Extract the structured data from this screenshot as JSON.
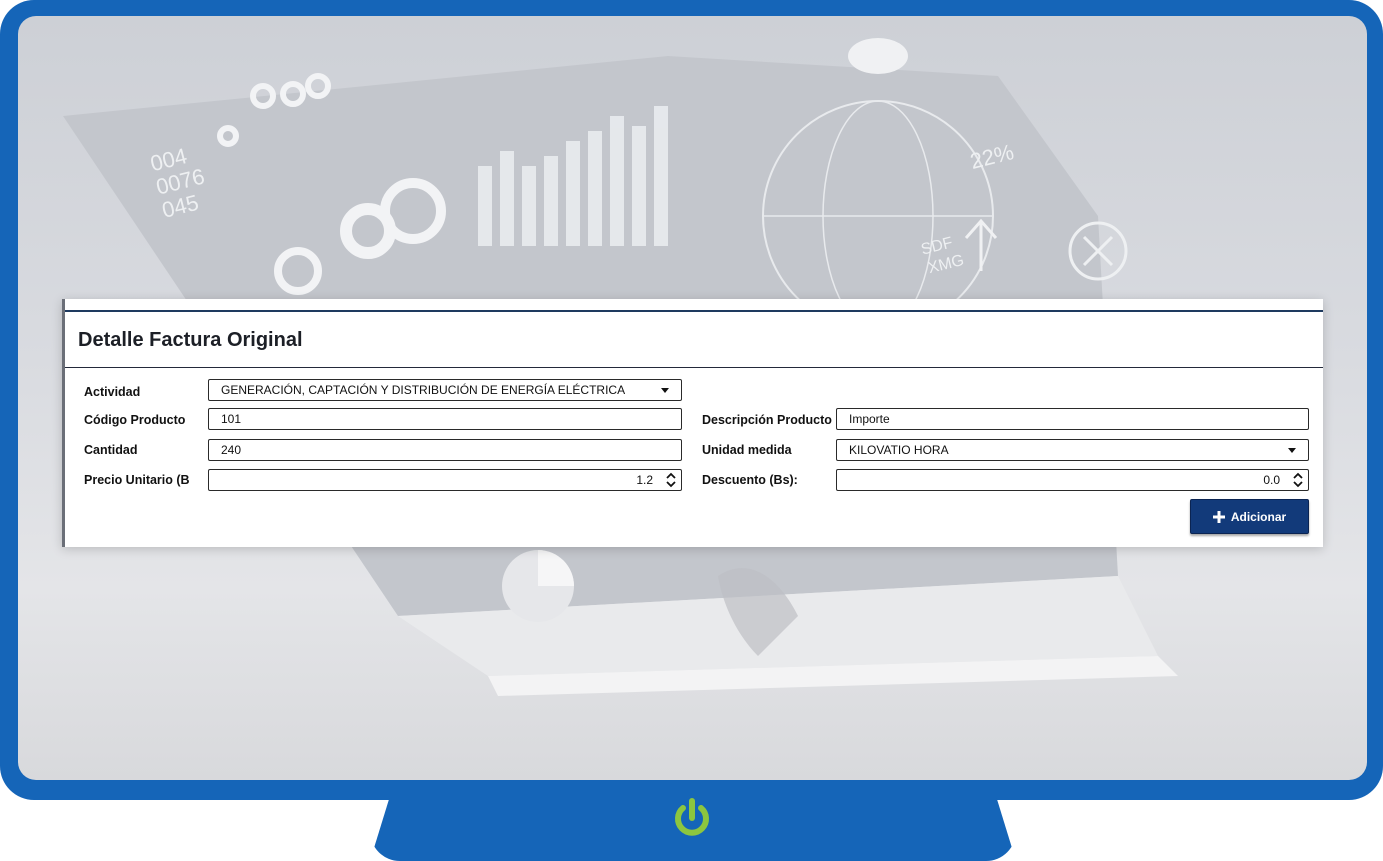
{
  "form": {
    "title": "Detalle Factura Original",
    "actividad": {
      "label": "Actividad",
      "value": "GENERACIÓN, CAPTACIÓN Y DISTRIBUCIÓN DE ENERGÍA ELÉCTRICA"
    },
    "codigo_producto": {
      "label": "Código Producto",
      "value": "101"
    },
    "descripcion_producto": {
      "label": "Descripción Producto",
      "value": "Importe"
    },
    "cantidad": {
      "label": "Cantidad",
      "value": "240"
    },
    "unidad_medida": {
      "label": "Unidad medida",
      "value": "KILOVATIO HORA"
    },
    "precio_unitario": {
      "label": "Precio Unitario (Bs",
      "value": "1.2"
    },
    "descuento": {
      "label": "Descuento (Bs):",
      "value": "0.0"
    },
    "add_button": {
      "label": "Adicionar",
      "icon": "plus-icon"
    }
  },
  "background_text": {
    "numbers": [
      "004",
      "0076",
      "045"
    ],
    "percent": "22%",
    "sdf": "SDF",
    "xmg": "XMG"
  },
  "colors": {
    "frame": "#1565b8",
    "power": "#8cc63f",
    "button": "#123a7a",
    "title_rule": "#1e3a5f"
  },
  "power_icon": "power-icon"
}
